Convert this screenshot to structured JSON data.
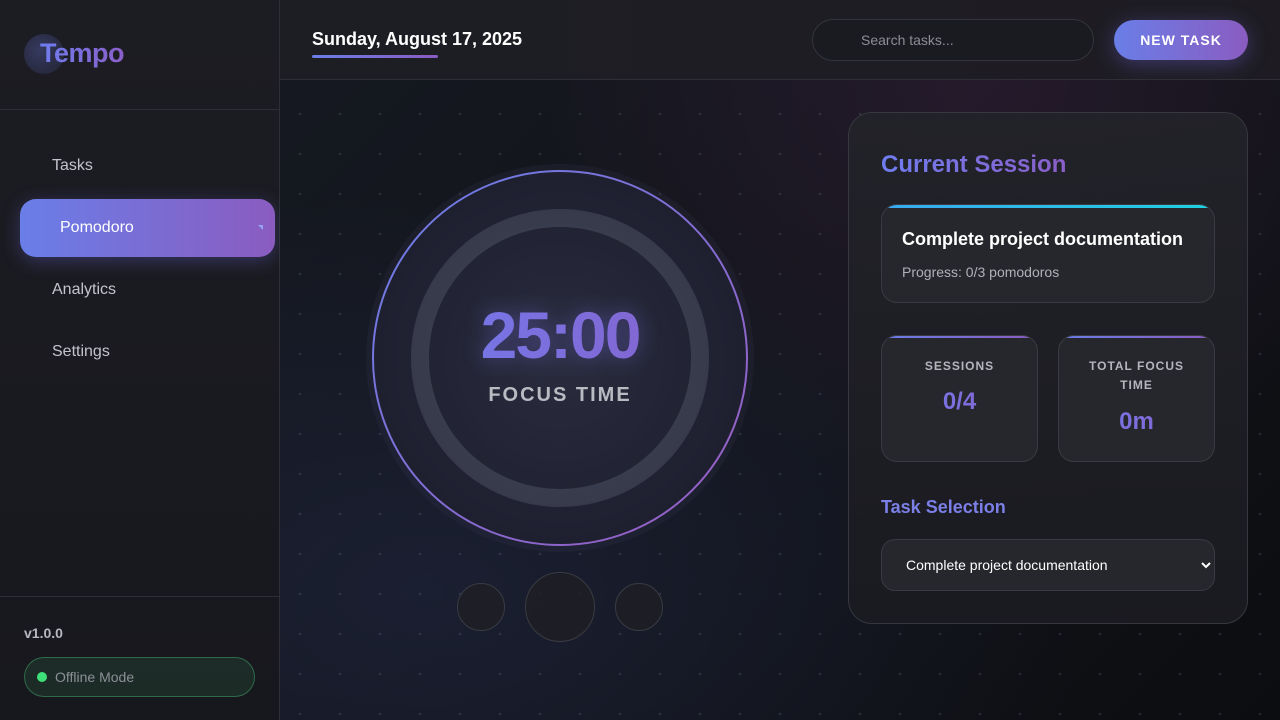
{
  "app": {
    "name": "Tempo"
  },
  "sidebar": {
    "items": [
      {
        "label": "Tasks"
      },
      {
        "label": "Pomodoro",
        "active": true
      },
      {
        "label": "Analytics"
      },
      {
        "label": "Settings"
      }
    ],
    "version": "v1.0.0",
    "status": "Offline Mode"
  },
  "header": {
    "date": "Sunday, August 17, 2025",
    "search_placeholder": "Search tasks...",
    "new_task_label": "NEW TASK"
  },
  "timer": {
    "time": "25:00",
    "mode_label": "FOCUS TIME",
    "progress": 0
  },
  "session": {
    "title": "Current Session",
    "task_name": "Complete project documentation",
    "task_progress": "Progress: 0/3 pomodoros",
    "stats": [
      {
        "label": "SESSIONS",
        "value": "0/4"
      },
      {
        "label": "TOTAL FOCUS TIME",
        "value": "0m"
      }
    ],
    "task_selection_title": "Task Selection",
    "task_options": [
      "Complete project documentation"
    ],
    "selected_task": "Complete project documentation"
  },
  "colors": {
    "accent_start": "#6a7ee8",
    "accent_end": "#8a5cc0",
    "status_online": "#3ee07a",
    "task_bar": "#1fd0e0"
  }
}
